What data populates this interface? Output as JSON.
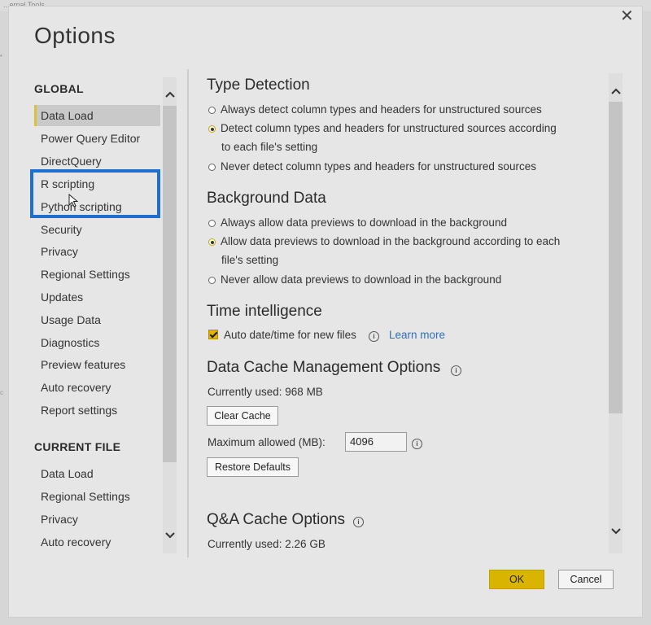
{
  "background": {
    "top_text": "...ernal Tools"
  },
  "dialog": {
    "title": "Options",
    "close_glyph": "✕"
  },
  "nav": {
    "global_heading": "GLOBAL",
    "global_items": [
      {
        "label": "Data Load",
        "active": true
      },
      {
        "label": "Power Query Editor"
      },
      {
        "label": "DirectQuery"
      },
      {
        "label": "R scripting"
      },
      {
        "label": "Python scripting"
      },
      {
        "label": "Security"
      },
      {
        "label": "Privacy"
      },
      {
        "label": "Regional Settings"
      },
      {
        "label": "Updates"
      },
      {
        "label": "Usage Data"
      },
      {
        "label": "Diagnostics"
      },
      {
        "label": "Preview features"
      },
      {
        "label": "Auto recovery"
      },
      {
        "label": "Report settings"
      }
    ],
    "current_heading": "CURRENT FILE",
    "current_items": [
      {
        "label": "Data Load"
      },
      {
        "label": "Regional Settings"
      },
      {
        "label": "Privacy"
      },
      {
        "label": "Auto recovery"
      }
    ]
  },
  "content": {
    "type_detection": {
      "title": "Type Detection",
      "options": [
        {
          "line1": "Always detect column types and headers for unstructured sources",
          "selected": false
        },
        {
          "line1": "Detect column types and headers for unstructured sources according",
          "line2": "to each file's setting",
          "selected": true
        },
        {
          "line1": "Never detect column types and headers for unstructured sources",
          "selected": false
        }
      ]
    },
    "background_data": {
      "title": "Background Data",
      "options": [
        {
          "line1": "Always allow data previews to download in the background",
          "selected": false
        },
        {
          "line1": "Allow data previews to download in the background according to each",
          "line2": "file's setting",
          "selected": true
        },
        {
          "line1": "Never allow data previews to download in the background",
          "selected": false
        }
      ]
    },
    "time_intelligence": {
      "title": "Time intelligence",
      "checkbox_label": "Auto date/time for new files",
      "checked": true,
      "learn_more": "Learn more"
    },
    "data_cache": {
      "title": "Data Cache Management Options",
      "currently_used": "Currently used: 968 MB",
      "clear_button": "Clear Cache",
      "max_label": "Maximum allowed (MB):",
      "max_value": "4096",
      "restore_button": "Restore Defaults"
    },
    "qa_cache": {
      "title": "Q&A Cache Options",
      "currently_used": "Currently used: 2.26 GB"
    }
  },
  "footer": {
    "ok": "OK",
    "cancel": "Cancel"
  },
  "colors": {
    "accent": "#d9b400",
    "highlight_box": "#1e6fd0",
    "link": "#2d6fbf"
  }
}
